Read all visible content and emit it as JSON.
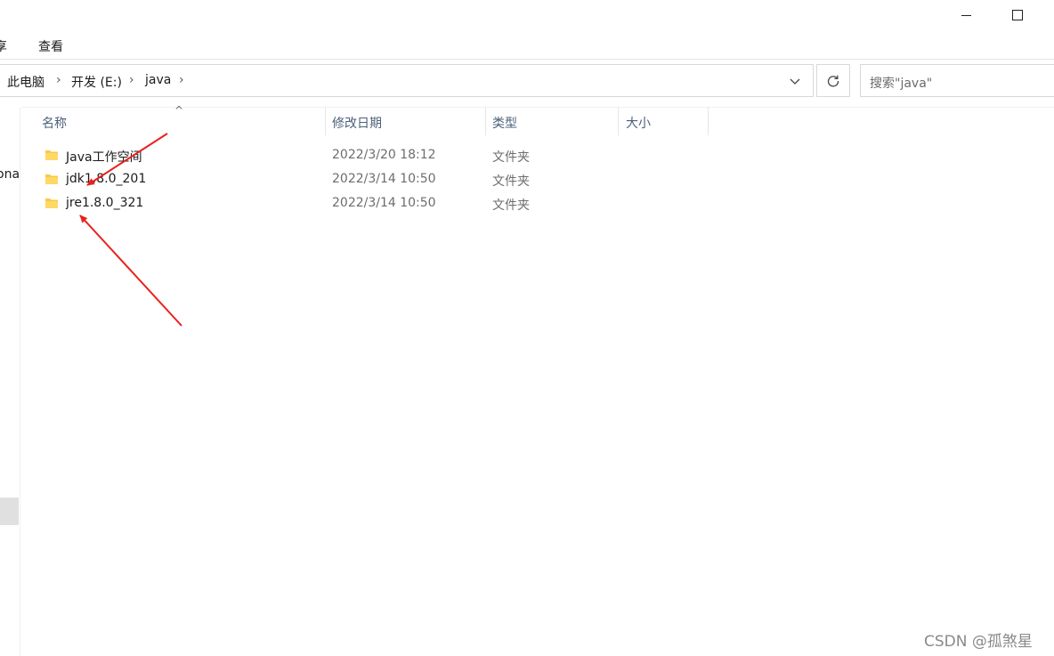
{
  "window": {
    "minimize_icon": "minimize-icon",
    "maximize_icon": "maximize-icon"
  },
  "ribbon": {
    "tab_share_fragment": "享",
    "tab_view": "查看"
  },
  "address": {
    "crumbs": [
      "此电脑",
      "开发 (E:)",
      "java"
    ],
    "dropdown_icon": "chevron-down-icon",
    "refresh_icon": "refresh-icon"
  },
  "search": {
    "placeholder": "搜索\"java\""
  },
  "nav": {
    "fragment": "ona"
  },
  "columns": {
    "name": "名称",
    "date": "修改日期",
    "type": "类型",
    "size": "大小"
  },
  "files": [
    {
      "name": "Java工作空间",
      "date": "2022/3/20 18:12",
      "type": "文件夹",
      "icon": "folder-icon"
    },
    {
      "name": "jdk1.8.0_201",
      "date": "2022/3/14 10:50",
      "type": "文件夹",
      "icon": "folder-icon"
    },
    {
      "name": "jre1.8.0_321",
      "date": "2022/3/14 10:50",
      "type": "文件夹",
      "icon": "folder-icon"
    }
  ],
  "annotations": {
    "arrow_color": "#e8211d"
  },
  "watermark": "CSDN @孤煞星"
}
